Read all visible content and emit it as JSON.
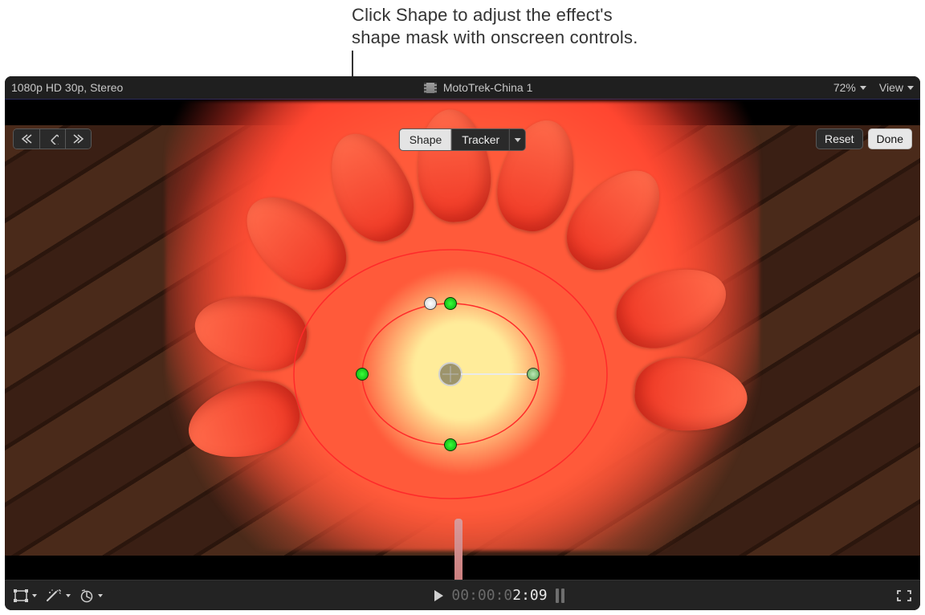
{
  "callout": {
    "line1": "Click Shape to adjust the effect's",
    "line2": "shape mask with onscreen controls."
  },
  "info_bar": {
    "format": "1080p HD 30p, Stereo",
    "clip_name": "MotoTrek-China 1",
    "zoom": "72%",
    "view_label": "View"
  },
  "segmented": {
    "shape": "Shape",
    "tracker": "Tracker"
  },
  "top_right": {
    "reset": "Reset",
    "done": "Done"
  },
  "timecode": {
    "dim": "00:00:0",
    "bright": "2:09"
  },
  "icons": {
    "prev": "prev-edit-icon",
    "keyframe": "keyframe-icon",
    "next": "next-edit-icon",
    "transform": "transform-tool-icon",
    "enhance": "enhance-tool-icon",
    "retime": "retime-tool-icon",
    "play": "play-icon",
    "fullscreen": "fullscreen-icon",
    "filmstrip": "filmstrip-icon"
  }
}
